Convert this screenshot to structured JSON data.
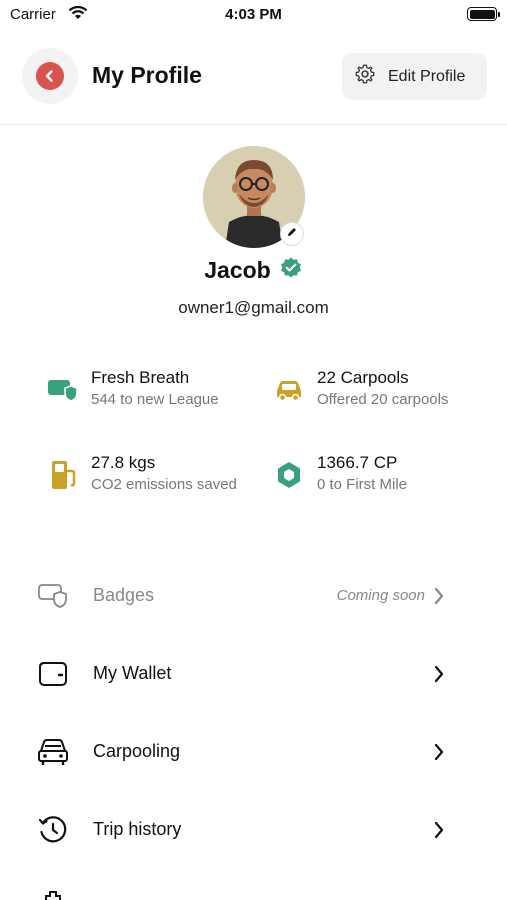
{
  "status_bar": {
    "carrier": "Carrier",
    "time": "4:03 PM"
  },
  "header": {
    "title": "My Profile",
    "edit_label": "Edit Profile",
    "back_color": "#d9534f"
  },
  "profile": {
    "name": "Jacob",
    "email": "owner1@gmail.com",
    "verified_color": "#3aa17e"
  },
  "stats": [
    {
      "icon": "shield-icon",
      "main": "Fresh Breath",
      "sub": "544 to new League",
      "color": "#3aa17e"
    },
    {
      "icon": "car-icon",
      "main": "22 Carpools",
      "sub": "Offered 20 carpools",
      "color": "#c9a227"
    },
    {
      "icon": "fuel-icon",
      "main": "27.8 kgs",
      "sub": "CO2 emissions saved",
      "color": "#c9a227"
    },
    {
      "icon": "hexagon-icon",
      "main": "1366.7 CP",
      "sub": "0 to First Mile",
      "color": "#3aa17e"
    }
  ],
  "menu": [
    {
      "icon": "badge-icon",
      "label": "Badges",
      "note": "Coming soon"
    },
    {
      "icon": "wallet-icon",
      "label": "My Wallet"
    },
    {
      "icon": "car-front-icon",
      "label": "Carpooling"
    },
    {
      "icon": "history-icon",
      "label": "Trip history"
    }
  ]
}
